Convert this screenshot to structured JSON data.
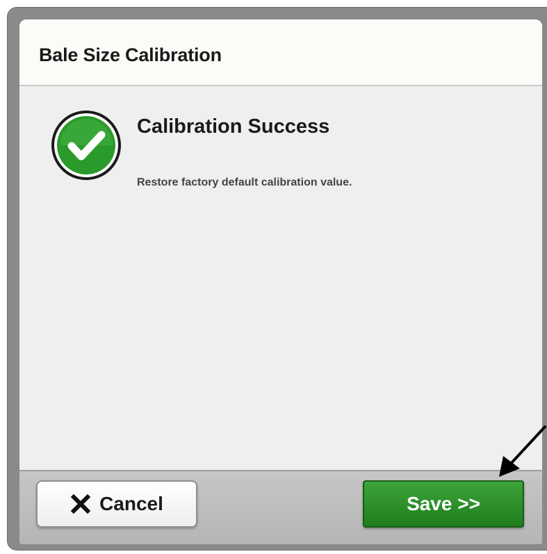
{
  "dialog": {
    "title": "Bale Size Calibration"
  },
  "message": {
    "status_icon": "check-circle-icon",
    "title": "Calibration Success",
    "body": "Restore factory default calibration value."
  },
  "footer": {
    "cancel_label": "Cancel",
    "cancel_icon": "close-x-icon",
    "save_label": "Save >>"
  },
  "annotation": {
    "pointer_icon": "pointer-arrow-icon"
  },
  "colors": {
    "save_button": "#2a8f27",
    "success_icon": "#2a9a2a"
  }
}
